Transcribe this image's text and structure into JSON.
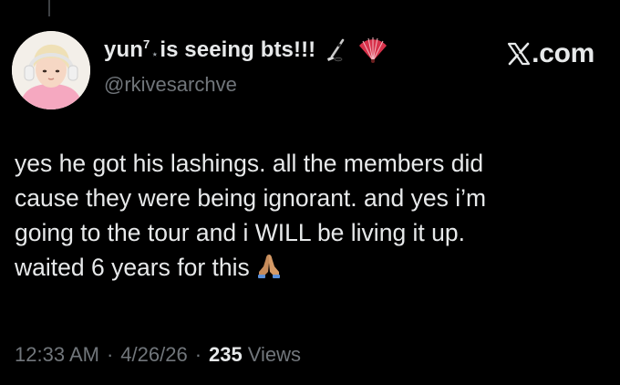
{
  "author": {
    "display_name": "yun",
    "name_superscript": "7",
    "name_separator": "⋆",
    "name_suffix": "is seeing bts!!!",
    "handle": "@rkivesarchve",
    "emoji": [
      "ice-hockey",
      "folding-fan"
    ]
  },
  "brand": {
    "text": ".com",
    "logo": "x-logo-icon"
  },
  "tweet": {
    "lines": [
      "yes he got his lashings. all the members did",
      "cause they were being ignorant. and yes i’m",
      "going to the tour and i WILL be living it up.",
      "waited 6 years for this"
    ],
    "end_emoji": "folded-hands"
  },
  "meta": {
    "time": "12:33 AM",
    "sep1": "·",
    "date": "4/26/26",
    "sep2": "·",
    "views_count": "235",
    "views_label": "Views"
  },
  "colors": {
    "background": "#000000",
    "text": "#e7e9ea",
    "muted": "#71767b"
  }
}
